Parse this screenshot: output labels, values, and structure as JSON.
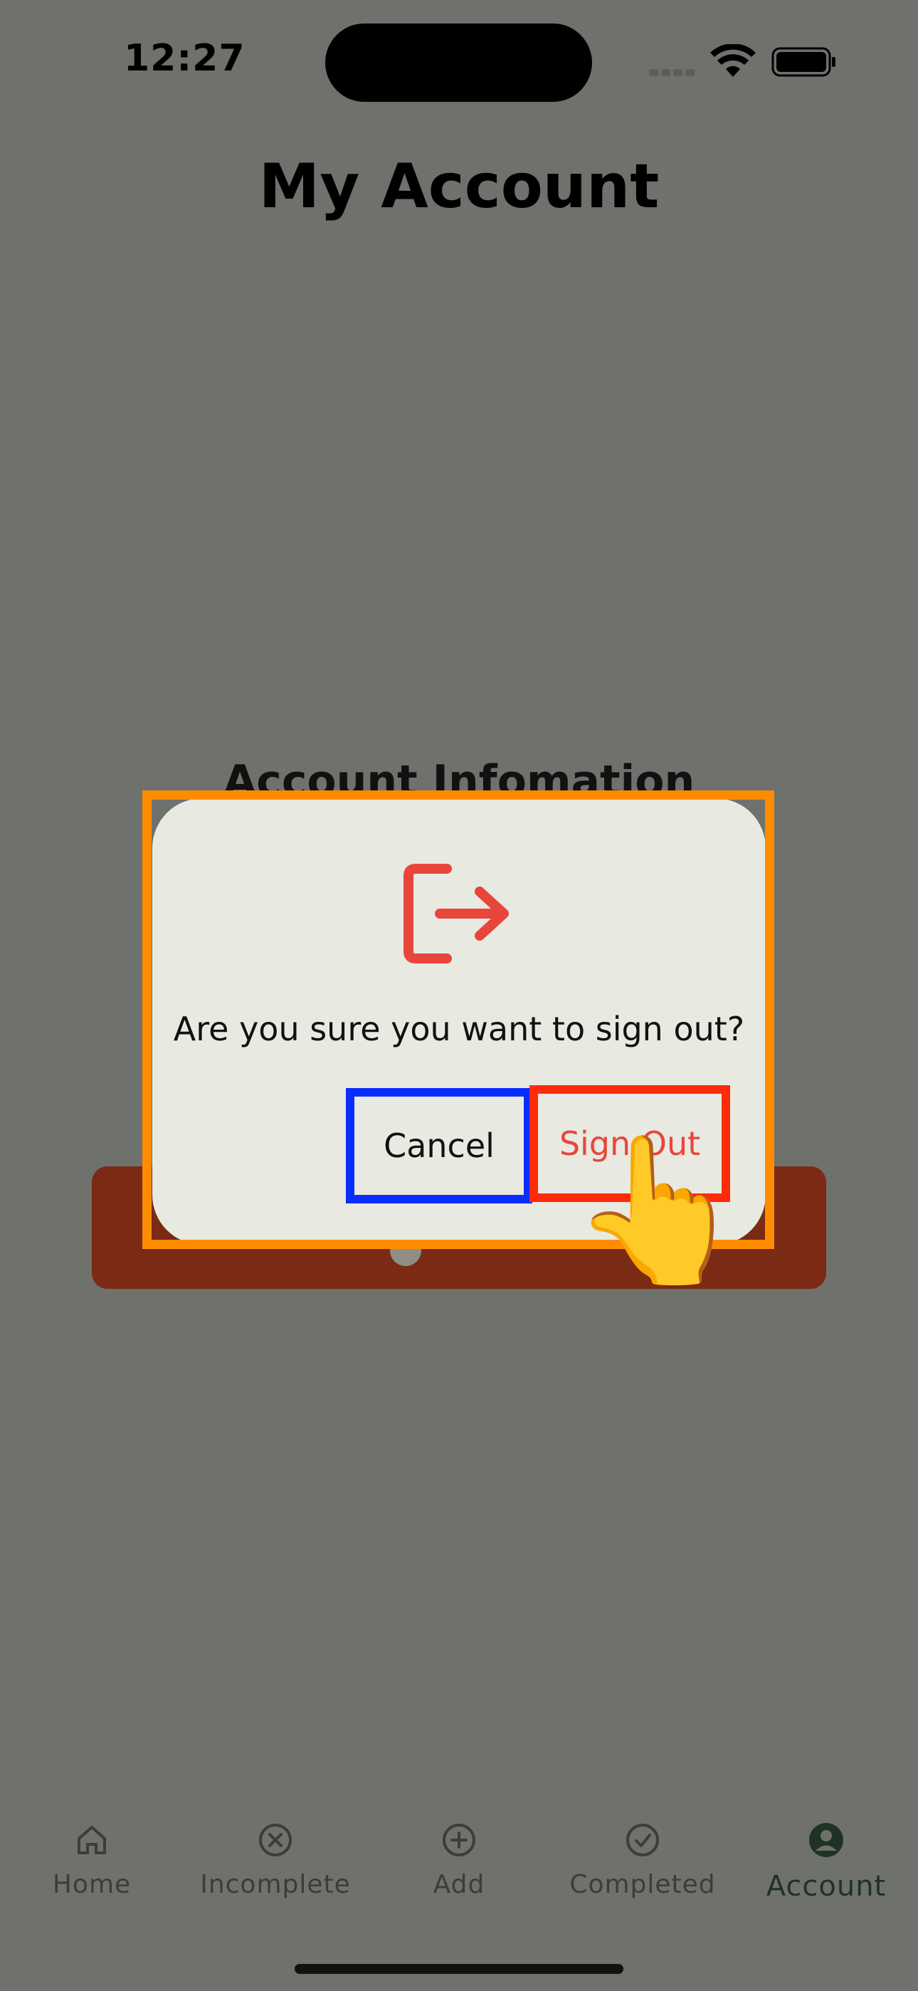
{
  "status_bar": {
    "time": "12:27"
  },
  "header": {
    "title": "My Account"
  },
  "main": {
    "section_title": "Account Infomation"
  },
  "dialog": {
    "message": "Are you sure you want to sign out?",
    "cancel_label": "Cancel",
    "signout_label": "Sign Out",
    "icon": "logout-icon",
    "accent_color": "#e8463a"
  },
  "tabs": [
    {
      "label": "Home",
      "icon": "home-icon"
    },
    {
      "label": "Incomplete",
      "icon": "x-circle-icon"
    },
    {
      "label": "Add",
      "icon": "plus-circle-icon"
    },
    {
      "label": "Completed",
      "icon": "check-circle-icon"
    },
    {
      "label": "Account",
      "icon": "account-circle-icon",
      "active": true
    }
  ],
  "colors": {
    "overlay_background": "#6f716c",
    "dialog_background": "#e8e9e1",
    "signout_bar": "#7b2a14",
    "highlight_dialog": "#ff8c00",
    "highlight_cancel": "#0a2dff",
    "highlight_signout": "#ff2a0a"
  }
}
